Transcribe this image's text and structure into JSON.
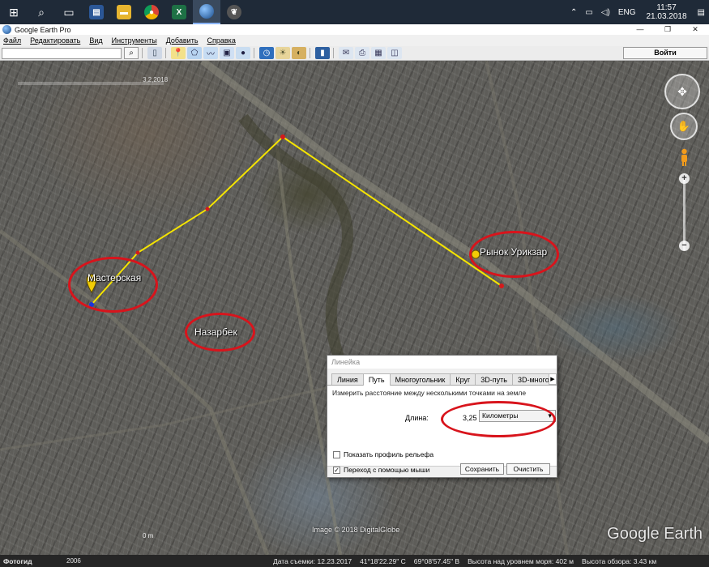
{
  "taskbar": {
    "apps": [
      {
        "name": "start-icon",
        "glyph": "⊞"
      },
      {
        "name": "search-icon",
        "glyph": "⌕"
      },
      {
        "name": "task-view-icon",
        "glyph": "▭"
      },
      {
        "name": "save-icon",
        "glyph": "💾"
      },
      {
        "name": "folder-icon",
        "glyph": "▬"
      },
      {
        "name": "chrome-icon",
        "glyph": "●"
      },
      {
        "name": "excel-icon",
        "glyph": "X"
      },
      {
        "name": "google-earth-icon",
        "glyph": "◉"
      },
      {
        "name": "bird-icon",
        "glyph": "❦"
      }
    ],
    "tray": {
      "language": "ENG",
      "time": "11:57",
      "date": "21.03.2018"
    }
  },
  "window": {
    "title": "Google Earth Pro",
    "minimize": "—",
    "maximize": "❐",
    "close": "✕"
  },
  "menu": [
    "Файл",
    "Редактировать",
    "Вид",
    "Инструменты",
    "Добавить",
    "Справка"
  ],
  "toolbar": {
    "search_value": "",
    "login_label": "Войти"
  },
  "map": {
    "labels": {
      "workshop": "Мастерская",
      "market": "Рынок Урикзар",
      "district": "Назарбек"
    },
    "top_ruler": "3,2,2018",
    "copyright": "Image © 2018 DigitalGlobe",
    "watermark": "Google Earth",
    "scale": "0 m"
  },
  "ruler_dialog": {
    "title": "Линейка",
    "tabs": [
      "Линия",
      "Путь",
      "Многоугольник",
      "Круг",
      "3D-путь",
      "3D-много"
    ],
    "active_tab": "Путь",
    "description": "Измерить расстояние между несколькими точками на земле",
    "length_label": "Длина:",
    "length_value": "3,25",
    "unit": "Километры",
    "elevation_profile": "Показать профиль рельефа",
    "mouse_nav": "Переход с помощью мыши",
    "save": "Сохранить",
    "clear": "Очистить"
  },
  "statusbar": {
    "tour": "Фотогид",
    "year": "2006",
    "date": "Дата съемки: 12.23.2017",
    "lat": "41°18'22.29\" С",
    "lon": "69°08'57.45\" В",
    "elevation": "Высота над уровнем моря: 402 м",
    "eye_alt": "Высота обзора: 3.43 км"
  },
  "colors": {
    "path": "#f5e400",
    "marker": "#f3cd05",
    "highlight": "#d8141c"
  }
}
